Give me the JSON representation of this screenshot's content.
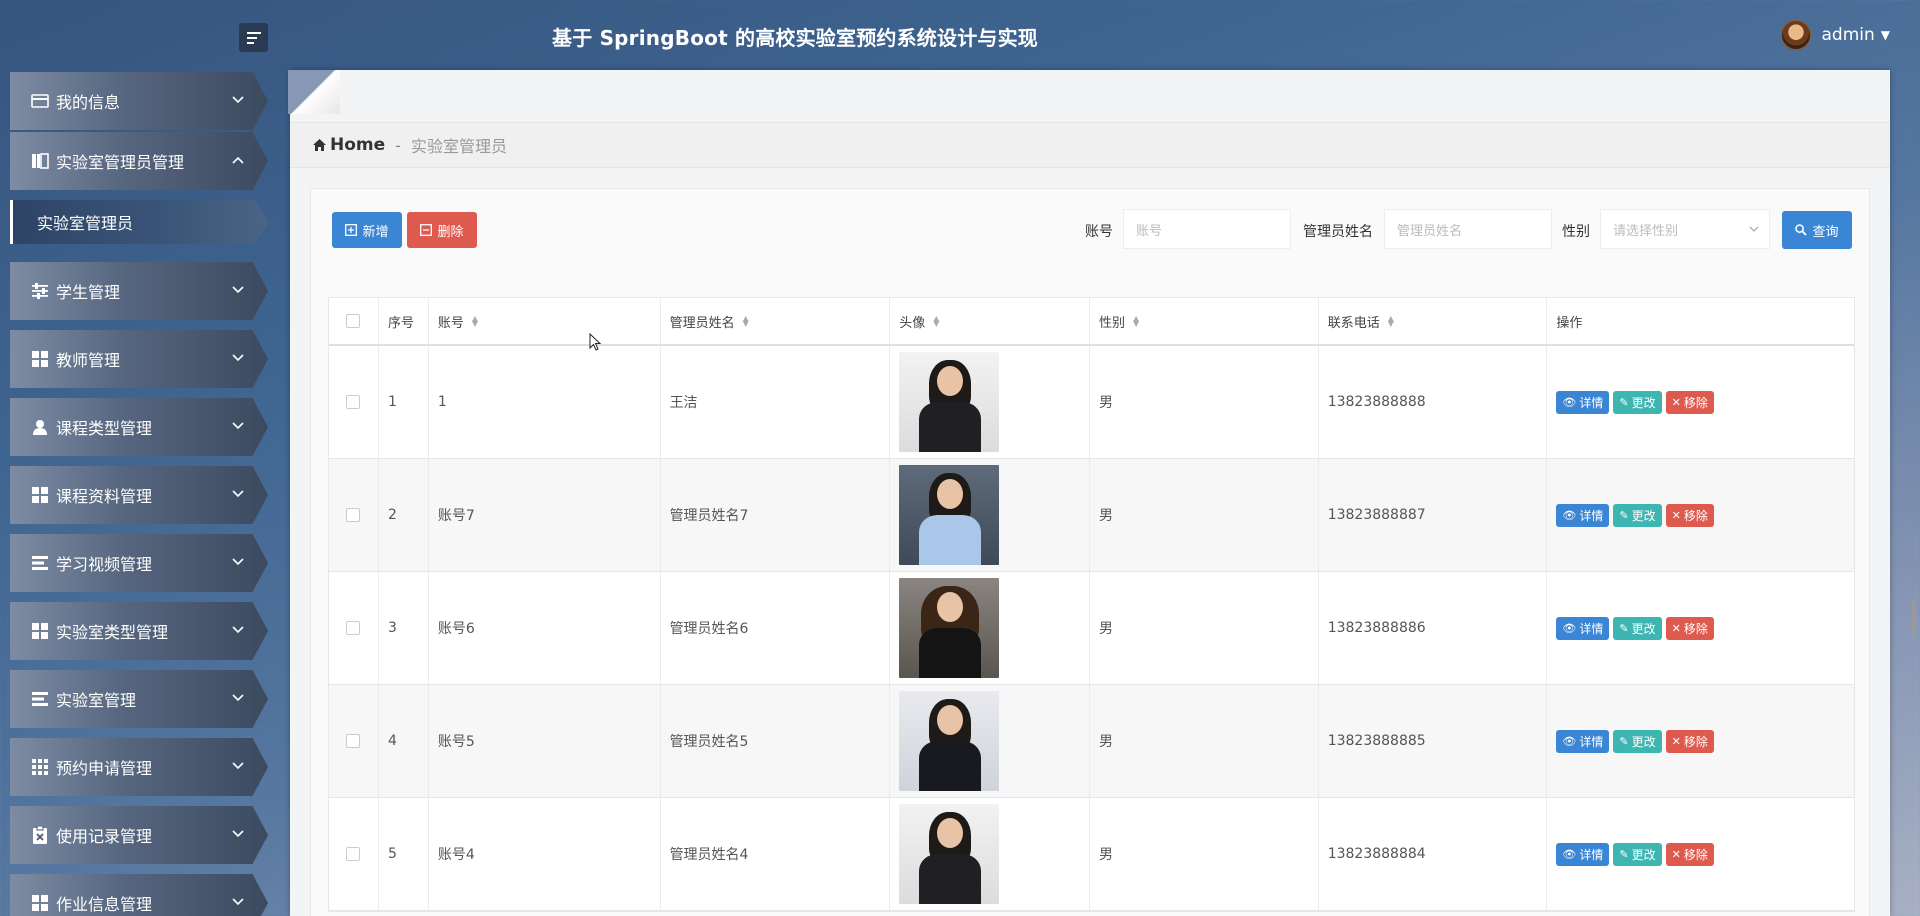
{
  "header": {
    "title": "基于 SpringBoot 的高校实验室预约系统设计与实现",
    "user": "admin"
  },
  "sidebar": {
    "items": [
      {
        "label": "我的信息",
        "icon": "card-icon",
        "expanded": false
      },
      {
        "label": "实验室管理员管理",
        "icon": "book-icon",
        "expanded": true
      },
      {
        "label": "学生管理",
        "icon": "sliders-icon",
        "expanded": false
      },
      {
        "label": "教师管理",
        "icon": "grid-icon",
        "expanded": false
      },
      {
        "label": "课程类型管理",
        "icon": "user-icon",
        "expanded": false
      },
      {
        "label": "课程资料管理",
        "icon": "grid-icon",
        "expanded": false
      },
      {
        "label": "学习视频管理",
        "icon": "list-icon",
        "expanded": false
      },
      {
        "label": "实验室类型管理",
        "icon": "grid-icon",
        "expanded": false
      },
      {
        "label": "实验室管理",
        "icon": "list-icon",
        "expanded": false
      },
      {
        "label": "预约申请管理",
        "icon": "apps-icon",
        "expanded": false
      },
      {
        "label": "使用记录管理",
        "icon": "clipboard-icon",
        "expanded": false
      },
      {
        "label": "作业信息管理",
        "icon": "grid-icon",
        "expanded": false
      }
    ],
    "active_sub": "实验室管理员"
  },
  "breadcrumb": {
    "home": "Home",
    "separator": "-",
    "current": "实验室管理员"
  },
  "toolbar": {
    "add_label": "新增",
    "delete_label": "删除",
    "search_label": "查询",
    "filters": {
      "account_label": "账号",
      "account_placeholder": "账号",
      "name_label": "管理员姓名",
      "name_placeholder": "管理员姓名",
      "gender_label": "性别",
      "gender_placeholder": "请选择性别"
    }
  },
  "table": {
    "columns": [
      "序号",
      "账号",
      "管理员姓名",
      "头像",
      "性别",
      "联系电话",
      "操作"
    ],
    "actions": {
      "detail": "详情",
      "edit": "更改",
      "remove": "移除"
    },
    "rows": [
      {
        "index": "1",
        "account": "1",
        "name": "王洁",
        "gender": "男",
        "phone": "13823888888"
      },
      {
        "index": "2",
        "account": "账号7",
        "name": "管理员姓名7",
        "gender": "男",
        "phone": "13823888887"
      },
      {
        "index": "3",
        "account": "账号6",
        "name": "管理员姓名6",
        "gender": "男",
        "phone": "13823888886"
      },
      {
        "index": "4",
        "account": "账号5",
        "name": "管理员姓名5",
        "gender": "男",
        "phone": "13823888885"
      },
      {
        "index": "5",
        "account": "账号4",
        "name": "管理员姓名4",
        "gender": "男",
        "phone": "13823888884"
      }
    ]
  },
  "colors": {
    "primary": "#3b86d4",
    "danger": "#df5a4e",
    "teal": "#3db5b0"
  }
}
